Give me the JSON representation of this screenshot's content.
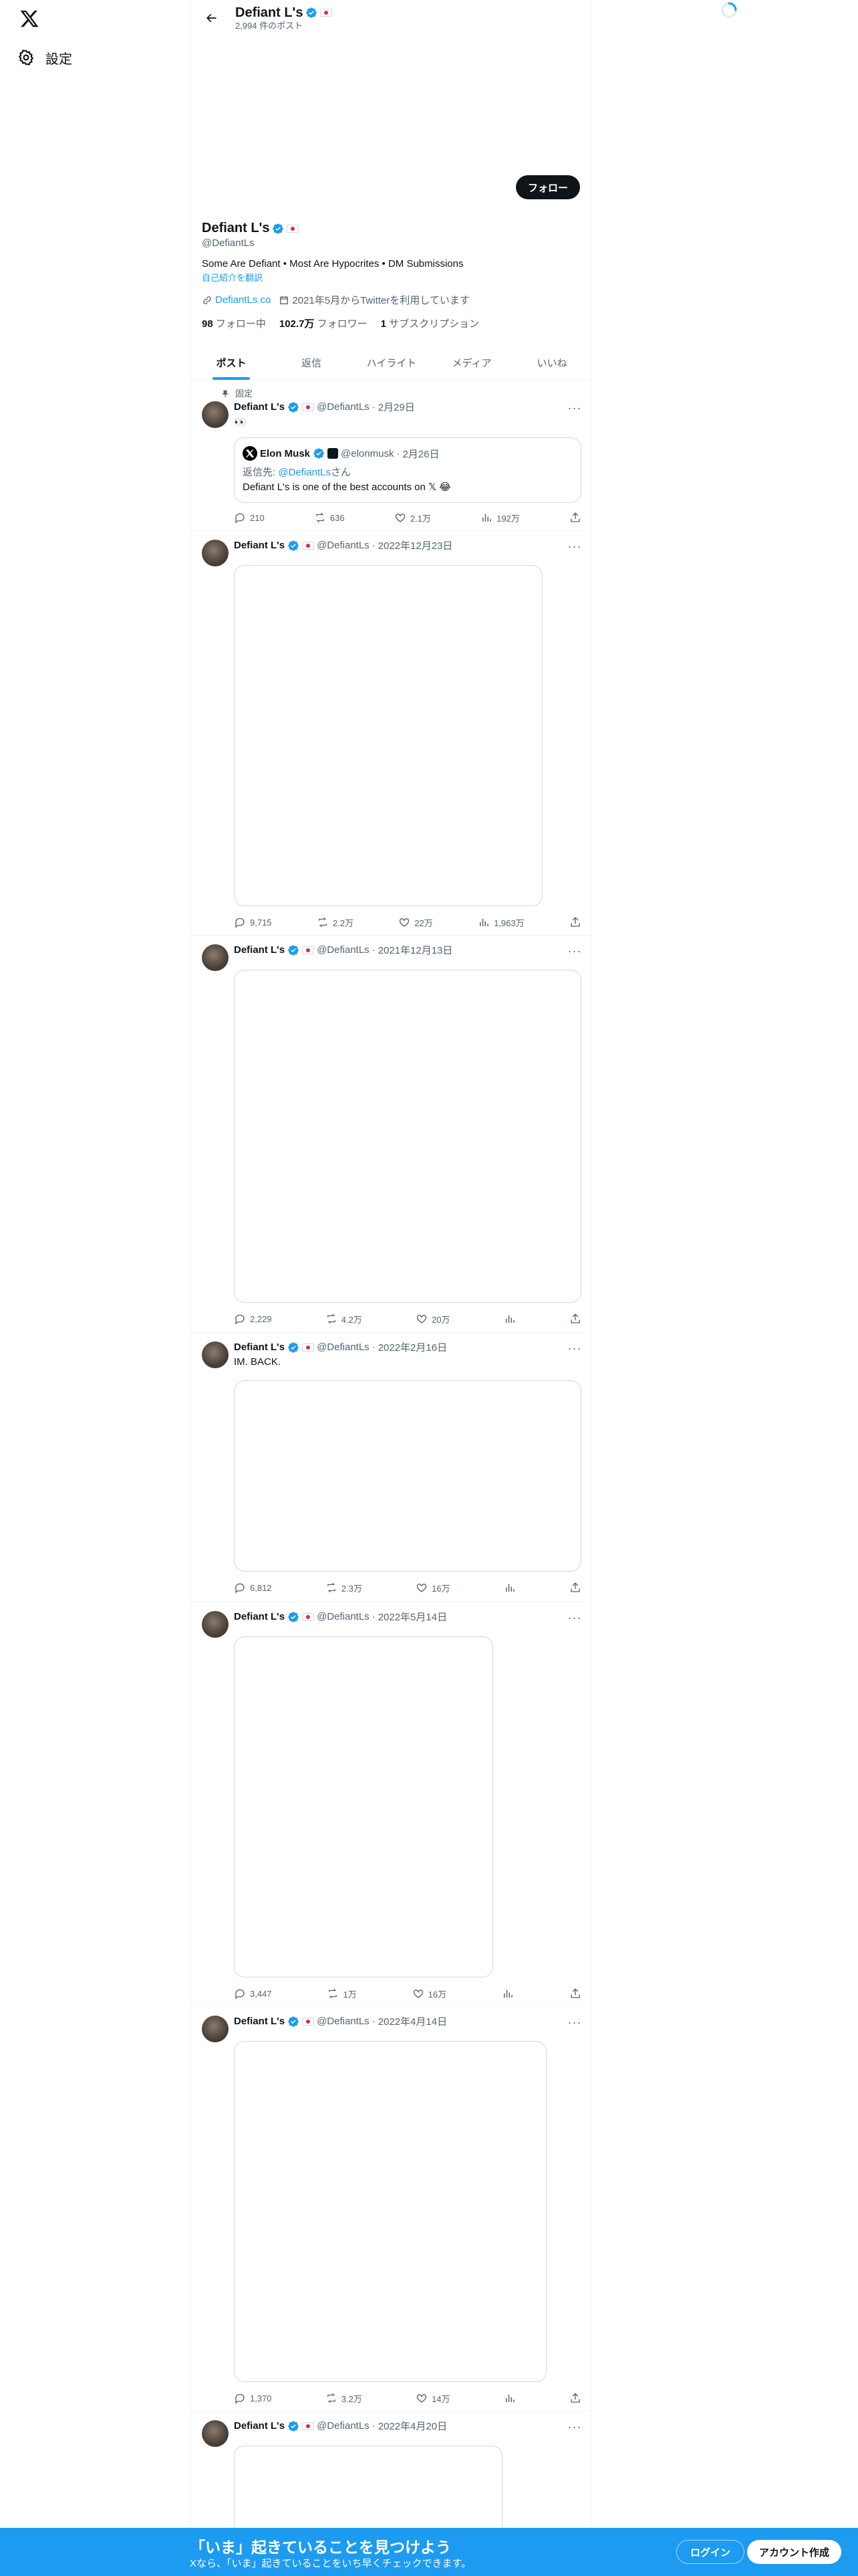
{
  "nav": {
    "settings_label": "設定"
  },
  "header": {
    "name": "Defiant L's",
    "post_count": "2,994 件のポスト"
  },
  "profile": {
    "follow_label": "フォロー",
    "name": "Defiant L's",
    "handle": "@DefiantLs",
    "bio": "Some Are Defiant • Most Are Hypocrites • DM Submissions",
    "translate": "自己紹介を翻訳",
    "website": "DefiantLs.co",
    "joined": "2021年5月からTwitterを利用しています",
    "following_count": "98",
    "following_label": "フォロー中",
    "followers_count": "102.7万",
    "followers_label": "フォロワー",
    "subs_count": "1",
    "subs_label": "サブスクリプション"
  },
  "tabs": [
    "ポスト",
    "返信",
    "ハイライト",
    "メディア",
    "いいね"
  ],
  "pinned_label": "固定",
  "posts": [
    {
      "name": "Defiant L's",
      "handle": "@DefiantLs",
      "date": "2月29日",
      "text": "👀",
      "quote": {
        "name": "Elon Musk",
        "handle": "@elonmusk",
        "date": "2月26日",
        "reply_prefix": "返信先: ",
        "reply_to": "@DefiantLs",
        "reply_suffix": "さん",
        "text": "Defiant L's is one of the best accounts on 𝕏 😂"
      },
      "replies": "210",
      "reposts": "636",
      "likes": "2.1万",
      "views": "192万"
    },
    {
      "name": "Defiant L's",
      "handle": "@DefiantLs",
      "date": "2022年12月23日",
      "text": "",
      "replies": "9,715",
      "reposts": "2.2万",
      "likes": "22万",
      "views": "1,963万"
    },
    {
      "name": "Defiant L's",
      "handle": "@DefiantLs",
      "date": "2021年12月13日",
      "text": "",
      "replies": "2,229",
      "reposts": "4.2万",
      "likes": "20万",
      "views": ""
    },
    {
      "name": "Defiant L's",
      "handle": "@DefiantLs",
      "date": "2022年2月16日",
      "text": "IM. BACK.",
      "replies": "6,812",
      "reposts": "2.3万",
      "likes": "16万",
      "views": ""
    },
    {
      "name": "Defiant L's",
      "handle": "@DefiantLs",
      "date": "2022年5月14日",
      "text": "",
      "replies": "3,447",
      "reposts": "1万",
      "likes": "16万",
      "views": ""
    },
    {
      "name": "Defiant L's",
      "handle": "@DefiantLs",
      "date": "2022年4月14日",
      "text": "",
      "replies": "1,370",
      "reposts": "3.2万",
      "likes": "14万",
      "views": ""
    },
    {
      "name": "Defiant L's",
      "handle": "@DefiantLs",
      "date": "2022年4月20日",
      "text": ""
    }
  ],
  "bottom_bar": {
    "title": "「いま」起きていることを見つけよう",
    "subtitle": "Xなら、「いま」起きていることをいち早くチェックできます。",
    "login": "ログイン",
    "signup": "アカウント作成"
  },
  "colors": {
    "accent": "#1d9bf0",
    "text": "#0f1419",
    "muted": "#536471",
    "border": "#eff3f4"
  }
}
